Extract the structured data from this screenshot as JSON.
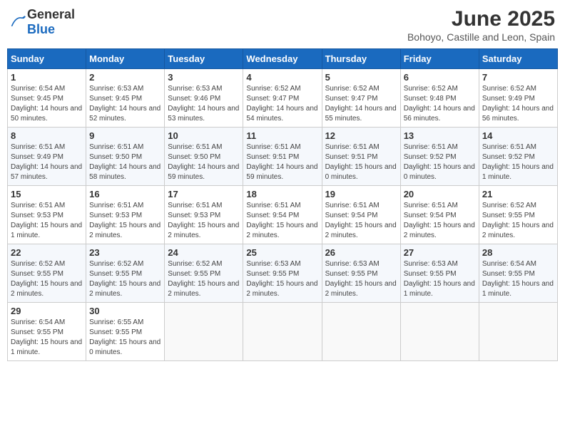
{
  "logo": {
    "text_general": "General",
    "text_blue": "Blue"
  },
  "title": "June 2025",
  "subtitle": "Bohoyo, Castille and Leon, Spain",
  "headers": [
    "Sunday",
    "Monday",
    "Tuesday",
    "Wednesday",
    "Thursday",
    "Friday",
    "Saturday"
  ],
  "weeks": [
    [
      {
        "day": "1",
        "sunrise": "6:54 AM",
        "sunset": "9:45 PM",
        "daylight": "14 hours and 50 minutes."
      },
      {
        "day": "2",
        "sunrise": "6:53 AM",
        "sunset": "9:45 PM",
        "daylight": "14 hours and 52 minutes."
      },
      {
        "day": "3",
        "sunrise": "6:53 AM",
        "sunset": "9:46 PM",
        "daylight": "14 hours and 53 minutes."
      },
      {
        "day": "4",
        "sunrise": "6:52 AM",
        "sunset": "9:47 PM",
        "daylight": "14 hours and 54 minutes."
      },
      {
        "day": "5",
        "sunrise": "6:52 AM",
        "sunset": "9:47 PM",
        "daylight": "14 hours and 55 minutes."
      },
      {
        "day": "6",
        "sunrise": "6:52 AM",
        "sunset": "9:48 PM",
        "daylight": "14 hours and 56 minutes."
      },
      {
        "day": "7",
        "sunrise": "6:52 AM",
        "sunset": "9:49 PM",
        "daylight": "14 hours and 56 minutes."
      }
    ],
    [
      {
        "day": "8",
        "sunrise": "6:51 AM",
        "sunset": "9:49 PM",
        "daylight": "14 hours and 57 minutes."
      },
      {
        "day": "9",
        "sunrise": "6:51 AM",
        "sunset": "9:50 PM",
        "daylight": "14 hours and 58 minutes."
      },
      {
        "day": "10",
        "sunrise": "6:51 AM",
        "sunset": "9:50 PM",
        "daylight": "14 hours and 59 minutes."
      },
      {
        "day": "11",
        "sunrise": "6:51 AM",
        "sunset": "9:51 PM",
        "daylight": "14 hours and 59 minutes."
      },
      {
        "day": "12",
        "sunrise": "6:51 AM",
        "sunset": "9:51 PM",
        "daylight": "15 hours and 0 minutes."
      },
      {
        "day": "13",
        "sunrise": "6:51 AM",
        "sunset": "9:52 PM",
        "daylight": "15 hours and 0 minutes."
      },
      {
        "day": "14",
        "sunrise": "6:51 AM",
        "sunset": "9:52 PM",
        "daylight": "15 hours and 1 minute."
      }
    ],
    [
      {
        "day": "15",
        "sunrise": "6:51 AM",
        "sunset": "9:53 PM",
        "daylight": "15 hours and 1 minute."
      },
      {
        "day": "16",
        "sunrise": "6:51 AM",
        "sunset": "9:53 PM",
        "daylight": "15 hours and 2 minutes."
      },
      {
        "day": "17",
        "sunrise": "6:51 AM",
        "sunset": "9:53 PM",
        "daylight": "15 hours and 2 minutes."
      },
      {
        "day": "18",
        "sunrise": "6:51 AM",
        "sunset": "9:54 PM",
        "daylight": "15 hours and 2 minutes."
      },
      {
        "day": "19",
        "sunrise": "6:51 AM",
        "sunset": "9:54 PM",
        "daylight": "15 hours and 2 minutes."
      },
      {
        "day": "20",
        "sunrise": "6:51 AM",
        "sunset": "9:54 PM",
        "daylight": "15 hours and 2 minutes."
      },
      {
        "day": "21",
        "sunrise": "6:52 AM",
        "sunset": "9:55 PM",
        "daylight": "15 hours and 2 minutes."
      }
    ],
    [
      {
        "day": "22",
        "sunrise": "6:52 AM",
        "sunset": "9:55 PM",
        "daylight": "15 hours and 2 minutes."
      },
      {
        "day": "23",
        "sunrise": "6:52 AM",
        "sunset": "9:55 PM",
        "daylight": "15 hours and 2 minutes."
      },
      {
        "day": "24",
        "sunrise": "6:52 AM",
        "sunset": "9:55 PM",
        "daylight": "15 hours and 2 minutes."
      },
      {
        "day": "25",
        "sunrise": "6:53 AM",
        "sunset": "9:55 PM",
        "daylight": "15 hours and 2 minutes."
      },
      {
        "day": "26",
        "sunrise": "6:53 AM",
        "sunset": "9:55 PM",
        "daylight": "15 hours and 2 minutes."
      },
      {
        "day": "27",
        "sunrise": "6:53 AM",
        "sunset": "9:55 PM",
        "daylight": "15 hours and 1 minute."
      },
      {
        "day": "28",
        "sunrise": "6:54 AM",
        "sunset": "9:55 PM",
        "daylight": "15 hours and 1 minute."
      }
    ],
    [
      {
        "day": "29",
        "sunrise": "6:54 AM",
        "sunset": "9:55 PM",
        "daylight": "15 hours and 1 minute."
      },
      {
        "day": "30",
        "sunrise": "6:55 AM",
        "sunset": "9:55 PM",
        "daylight": "15 hours and 0 minutes."
      },
      null,
      null,
      null,
      null,
      null
    ]
  ]
}
